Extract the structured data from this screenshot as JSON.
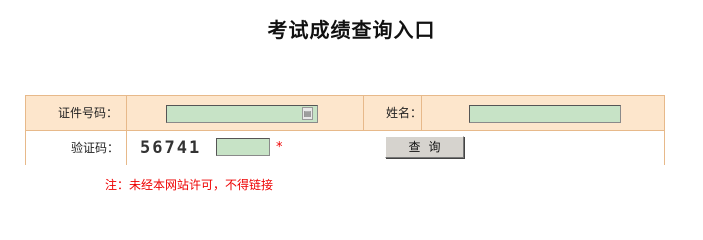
{
  "page": {
    "title": "考试成绩查询入口"
  },
  "form": {
    "id_label": "证件号码：",
    "id_value": "",
    "name_label": "姓名：",
    "name_value": "",
    "captcha_label": "验证码：",
    "captcha_image_text": "56741",
    "captcha_value": "",
    "required_mark": "*",
    "submit_label": "查询"
  },
  "notice": "注：未经本网站许可，不得链接",
  "colors": {
    "header_row_bg": "#fde6cc",
    "border": "#e7b98a",
    "input_bg": "#c7e3c6",
    "notice": "#e00000"
  },
  "icons": {
    "keyboard": "keyboard-icon"
  }
}
